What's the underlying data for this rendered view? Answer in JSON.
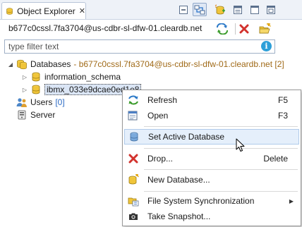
{
  "tab": {
    "title": "Object Explorer",
    "close_glyph": "✕"
  },
  "toolbar": {
    "buttons": [
      {
        "name": "collapse-all-icon"
      },
      {
        "name": "link-with-editor-icon",
        "pressed": true
      },
      {
        "name": "new-connection-icon"
      },
      {
        "name": "minimize-icon"
      },
      {
        "name": "maximize-icon"
      }
    ]
  },
  "connection": {
    "label": "b677c0cssl.7fa3704@us-cdbr-sl-dfw-01.cleardb.net",
    "buttons": [
      {
        "name": "reconnect-icon"
      },
      {
        "name": "disconnect-icon"
      },
      {
        "name": "open-folder-icon"
      }
    ]
  },
  "filter": {
    "placeholder": "type filter text",
    "info_glyph": "i"
  },
  "tree": {
    "databases": {
      "label": "Databases",
      "decoration": "- b677c0cssl.7fa3704@us-cdbr-sl-dfw-01.cleardb.net [2]",
      "expanded": true,
      "children": [
        {
          "label": "information_schema"
        },
        {
          "label": "ibmx_033e9dcae0ed1e8",
          "selected": true
        }
      ]
    },
    "users": {
      "label": "Users",
      "count": "[0]"
    },
    "server": {
      "label": "Server"
    }
  },
  "context_menu": {
    "items": [
      {
        "label": "Refresh",
        "accelerator": "F5",
        "icon": "refresh-icon"
      },
      {
        "label": "Open",
        "accelerator": "F3",
        "icon": "open-icon"
      },
      {
        "label": "Set Active Database",
        "accelerator": "",
        "icon": "database-icon",
        "hovered": true
      },
      {
        "label": "Drop...",
        "accelerator": "Delete",
        "icon": "drop-icon"
      },
      {
        "label": "New Database...",
        "accelerator": "",
        "icon": "new-database-icon"
      },
      {
        "label": "File System Synchronization",
        "accelerator": "",
        "icon": "sync-icon",
        "submenu": true
      },
      {
        "label": "Take Snapshot...",
        "accelerator": "",
        "icon": "camera-icon"
      }
    ]
  },
  "colors": {
    "decoration": "#a06a18",
    "count": "#2e6cc5",
    "hover_bg": "#e5effb",
    "info": "#2d9fd8",
    "drop_red": "#d2322d",
    "db_yellow": "#e8b21c"
  }
}
